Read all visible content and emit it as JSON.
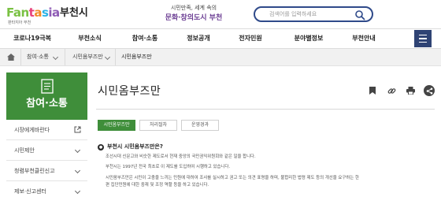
{
  "header": {
    "logo_parts": [
      "Fan",
      "t",
      "a",
      "s",
      "ia"
    ],
    "city": "부천시",
    "logo_tagline": "판타지아 부천",
    "slogan_line1": "시민만족, 세계 속의",
    "slogan_line2": "문화·창의도시 부천",
    "search_placeholder": "검색어를 입력하세요"
  },
  "nav": {
    "items": [
      "코로나19극복",
      "부천소식",
      "참여·소통",
      "정보공개",
      "전자민원",
      "분야별정보",
      "부천안내"
    ]
  },
  "breadcrumb": {
    "items": [
      "참여·소통",
      "시민옴부즈만",
      "시민옴부즈만"
    ]
  },
  "sidebar": {
    "title": "참여·소통",
    "items": [
      "시장에게바란다",
      "시민제안",
      "청렴부천클린신고",
      "제보·신고센터"
    ]
  },
  "main": {
    "title": "시민옴부즈만",
    "tabs": [
      "시민옴부즈만",
      "처리절차",
      "운영경과"
    ],
    "question": "부천시 시민옴부즈만은?",
    "paragraphs": [
      "조선시대 신문고와 비슷한 제도로서 현재 중앙의 국민권익위원회와 같은 일을 합니다.",
      "부천시는 1997년 전국 최초로 이 제도를 도입하여 시행하고 있습니다.",
      "시민옴부즈만은 시민이 고충을 느끼는 민원에 대하여 조사를 실시하고 권고 또는 의견 표명을 하며, 불합리한 법령 제도 등의 개선을 요구하는 한",
      "편 집단민원에 대한 중재 및 조정 역할 등을 하고 있습니다."
    ]
  },
  "colors": {
    "brand_navy": "#2f4a8a",
    "section_green": "#3f8e3a",
    "menu_button": "#2f4374"
  },
  "icons": [
    "search-icon",
    "home-icon",
    "menu-icon",
    "document-icon",
    "external-link-icon",
    "bookmark-icon",
    "link-icon",
    "print-icon",
    "share-icon"
  ]
}
